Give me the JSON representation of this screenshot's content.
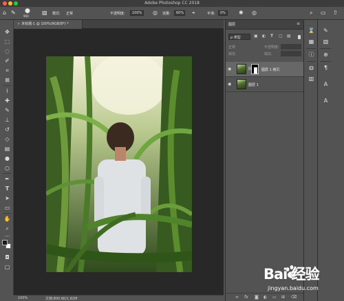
{
  "window": {
    "app_title": "Adobe Photoshop CC 2018"
  },
  "options_bar": {
    "brush_size": "900",
    "mode_label": "模式:",
    "mode_value": "正常",
    "opacity_label": "不透明度:",
    "opacity_value": "100%",
    "flow_label": "流量:",
    "flow_value": "60%",
    "smoothing_label": "平滑:",
    "smoothing_value": "0%"
  },
  "document": {
    "tab_title": "未标题-1 @ 100%(RGB/8*) *",
    "tab_close_glyph": "×"
  },
  "status_bar": {
    "zoom": "100%",
    "doc_info": "文档:800.6K/1.82M"
  },
  "layers_panel": {
    "tab_label": "图层",
    "menu_glyph": "≡",
    "filter_kind": "ρ 类型",
    "blend_mode": "正常",
    "opacity_label": "不透明度:",
    "lock_label": "锁定:",
    "fill_label": "填充:",
    "layers": [
      {
        "name": "图层 1 拷贝",
        "selected": true,
        "has_mask": true
      },
      {
        "name": "图层 1",
        "selected": false,
        "has_mask": false
      }
    ],
    "footer_icons": [
      "link-icon",
      "fx-icon",
      "mask-icon",
      "adjustment-icon",
      "folder-icon",
      "new-layer-icon",
      "trash-icon"
    ]
  },
  "toolbar": {
    "tools": [
      "move-icon",
      "marquee-icon",
      "lasso-icon",
      "quick-select-icon",
      "crop-icon",
      "frame-icon",
      "eyedropper-icon",
      "healing-icon",
      "brush-icon",
      "stamp-icon",
      "history-brush-icon",
      "eraser-icon",
      "gradient-icon",
      "blur-icon",
      "dodge-icon",
      "pen-icon",
      "type-icon",
      "path-select-icon",
      "rectangle-icon",
      "hand-icon",
      "zoom-icon",
      "more-icon"
    ]
  },
  "dock": {
    "column1": [
      "history-icon",
      "properties-icon",
      "info-icon",
      "adjustments-icon",
      "libraries-icon"
    ],
    "column2": [
      "tool-presets-icon",
      "brush-settings-icon",
      "clone-source-icon",
      "paragraph-icon",
      "character-icon",
      "glyphs-icon"
    ]
  },
  "watermark": {
    "logo": "Bai 经验",
    "url": "jingyan.baidu.com"
  },
  "colors": {
    "app_bg": "#535353",
    "canvas_bg": "#282828",
    "selected_layer": "#676767",
    "foreground_swatch": "#1a1a1a",
    "background_swatch": "#ffffff"
  }
}
